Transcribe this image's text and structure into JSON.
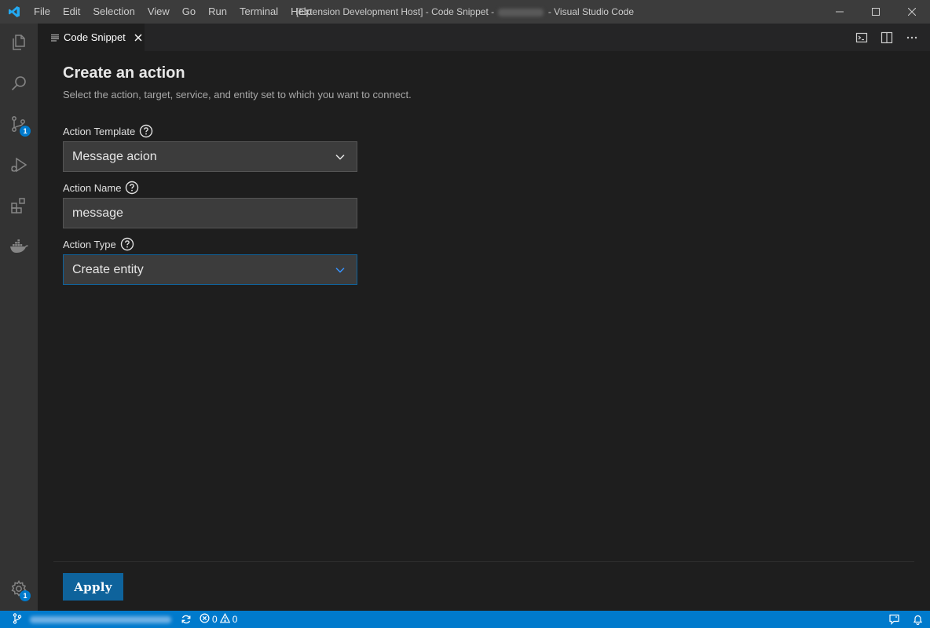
{
  "titlebar": {
    "menu": [
      "File",
      "Edit",
      "Selection",
      "View",
      "Go",
      "Run",
      "Terminal",
      "Help"
    ],
    "title_prefix": "[Extension Development Host] - Code Snippet -",
    "title_suffix": "- Visual Studio Code"
  },
  "activitybar": {
    "items": [
      "explorer-icon",
      "search-icon",
      "source-control-icon",
      "run-debug-icon",
      "extensions-icon",
      "docker-icon"
    ],
    "source_control_badge": "1",
    "manage_badge": "1"
  },
  "tab": {
    "label": "Code Snippet"
  },
  "form": {
    "title": "Create an action",
    "subtitle": "Select the action, target, service, and entity set to which you want to connect.",
    "template_label": "Action Template",
    "template_value": "Message acion",
    "name_label": "Action Name",
    "name_value": "message",
    "type_label": "Action Type",
    "type_value": "Create entity",
    "apply_label": "Apply"
  },
  "statusbar": {
    "errors": "0",
    "warnings": "0"
  },
  "colors": {
    "accent": "#007acc",
    "button": "#0e639c",
    "background": "#1e1e1e"
  }
}
